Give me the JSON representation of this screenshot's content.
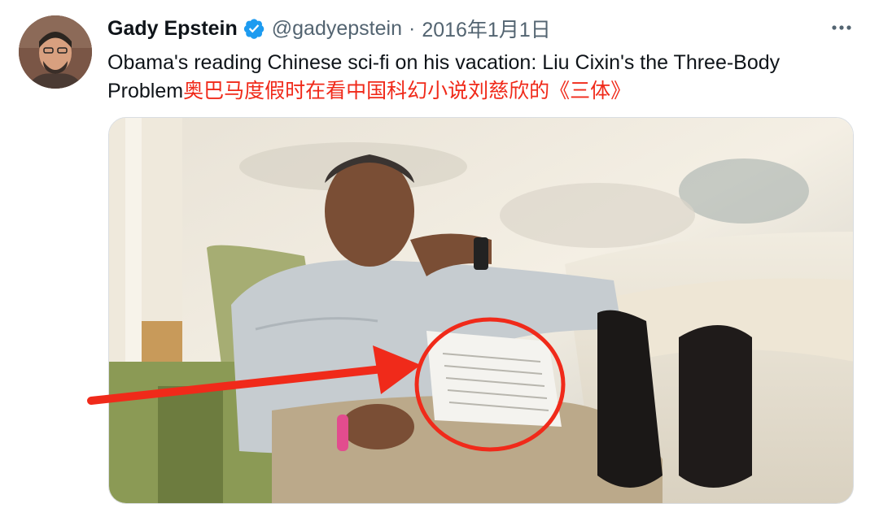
{
  "tweet": {
    "author_name": "Gady Epstein",
    "handle": "@gadyepstein",
    "separator": "·",
    "date": "2016年1月1日",
    "text_en": "Obama's reading Chinese sci-fi on his vacation: Liu Cixin's the Three-Body Problem",
    "text_cn": "奥巴马度假时在看中国科幻小说刘慈欣的《三体》"
  },
  "icons": {
    "verified": "verified-badge-icon",
    "more": "more-options-icon"
  },
  "colors": {
    "verified_blue": "#1d9bf0",
    "annotation_red": "#f02a1a",
    "handle_gray": "#536471"
  }
}
